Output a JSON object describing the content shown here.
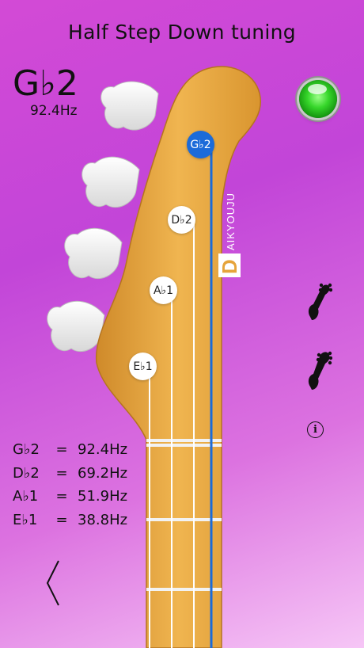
{
  "title": "Half Step Down tuning",
  "current_note": {
    "name": "G♭2",
    "frequency": "92.4Hz"
  },
  "strings": [
    {
      "label": "G♭2",
      "active": true
    },
    {
      "label": "D♭2",
      "active": false
    },
    {
      "label": "A♭1",
      "active": false
    },
    {
      "label": "E♭1",
      "active": false
    }
  ],
  "frequency_table": [
    {
      "note": "G♭2",
      "eq": "=",
      "hz": "92.4Hz"
    },
    {
      "note": "D♭2",
      "eq": "=",
      "hz": "69.2Hz"
    },
    {
      "note": "A♭1",
      "eq": "=",
      "hz": "51.9Hz"
    },
    {
      "note": "E♭1",
      "eq": "=",
      "hz": "38.8Hz"
    }
  ],
  "brand": "AIKYOUJU",
  "brand_initial": "D",
  "status_led": {
    "state": "green",
    "color": "#2ec424"
  },
  "icons": {
    "bass_4string": "bass-guitar-4-string-icon",
    "bass_5string": "bass-guitar-5-string-icon",
    "info": "info-icon",
    "back": "chevron-left-icon"
  },
  "info_glyph": "i",
  "colors": {
    "active_string": "#1b6bd9",
    "neck_wood": "#e6a43a",
    "background_top": "#d34ad6",
    "background_bottom": "#f6c6f6"
  }
}
